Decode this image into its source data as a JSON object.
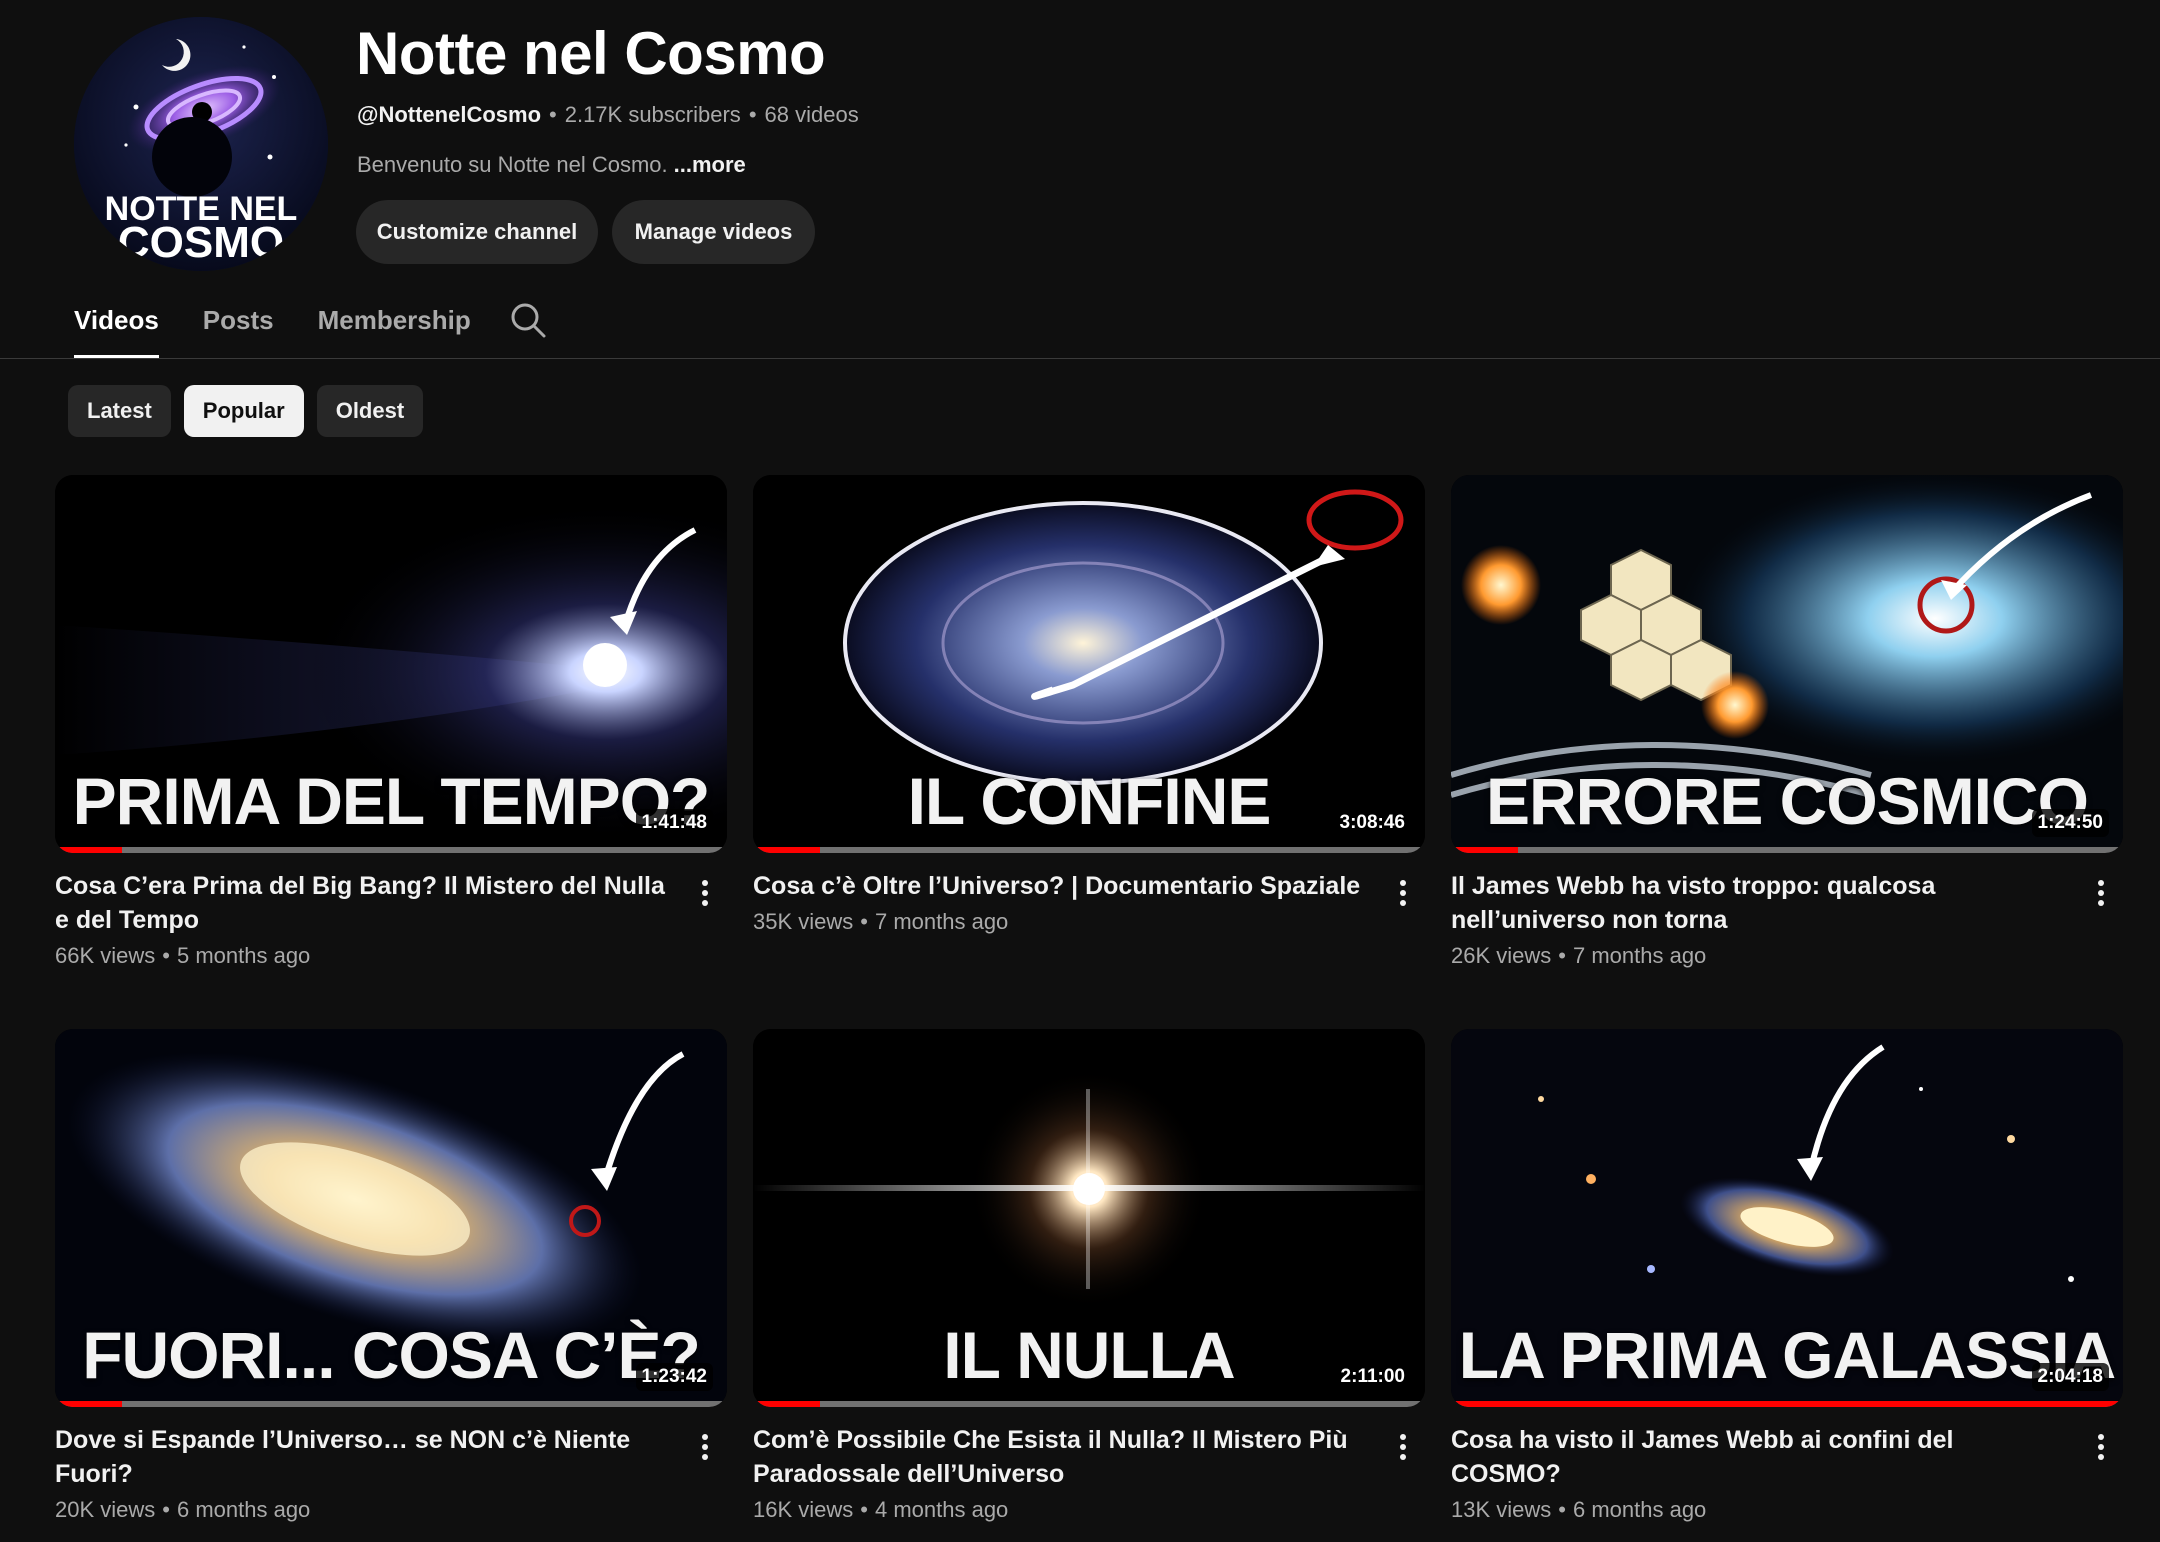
{
  "channel": {
    "avatar_text_line1": "NOTTE NEL",
    "avatar_text_line2": "COSMO",
    "title": "Notte nel Cosmo",
    "handle": "@NottenelCosmo",
    "subscribers": "2.17K subscribers",
    "video_count": "68 videos",
    "description": "Benvenuto su Notte nel Cosmo.",
    "more_label": "...more"
  },
  "buttons": {
    "customize": "Customize channel",
    "manage": "Manage videos"
  },
  "tabs": [
    {
      "label": "Videos",
      "active": true
    },
    {
      "label": "Posts",
      "active": false
    },
    {
      "label": "Membership",
      "active": false
    }
  ],
  "search_icon": "search-icon",
  "chips": [
    {
      "label": "Latest",
      "selected": false
    },
    {
      "label": "Popular",
      "selected": true
    },
    {
      "label": "Oldest",
      "selected": false
    }
  ],
  "videos": [
    {
      "thumb_text": "PRIMA DEL TEMPO?",
      "duration": "1:41:48",
      "progress": 0.1,
      "title": "Cosa C’era Prima del Big Bang? Il Mistero del Nulla e del Tempo",
      "views": "66K views",
      "age": "5 months ago"
    },
    {
      "thumb_text": "IL CONFINE",
      "duration": "3:08:46",
      "progress": 0.1,
      "title": "Cosa c’è Oltre l’Universo? | Documentario Spaziale",
      "views": "35K views",
      "age": "7 months ago"
    },
    {
      "thumb_text": "ERRORE COSMICO",
      "duration": "1:24:50",
      "progress": 0.1,
      "title": "Il James Webb ha visto troppo: qualcosa nell’universo non torna",
      "views": "26K views",
      "age": "7 months ago"
    },
    {
      "thumb_text": "FUORI... COSA C’È?",
      "duration": "1:23:42",
      "progress": 0.1,
      "title": "Dove si Espande l’Universo… se NON c’è Niente Fuori?",
      "views": "20K views",
      "age": "6 months ago"
    },
    {
      "thumb_text": "IL NULLA",
      "duration": "2:11:00",
      "progress": 0.1,
      "title": "Com’è Possibile Che Esista il Nulla? Il Mistero Più Paradossale dell’Universo",
      "views": "16K views",
      "age": "4 months ago"
    },
    {
      "thumb_text": "LA PRIMA GALASSIA",
      "duration": "2:04:18",
      "progress": 1.0,
      "title": "Cosa ha visto il James Webb ai confini del COSMO?",
      "views": "13K views",
      "age": "6 months ago"
    }
  ],
  "colors": {
    "background": "#0f0f0f",
    "chip": "#272727",
    "chip_selected": "#f1f1f1",
    "progress": "#ff0000",
    "secondary_text": "#aaaaaa"
  }
}
